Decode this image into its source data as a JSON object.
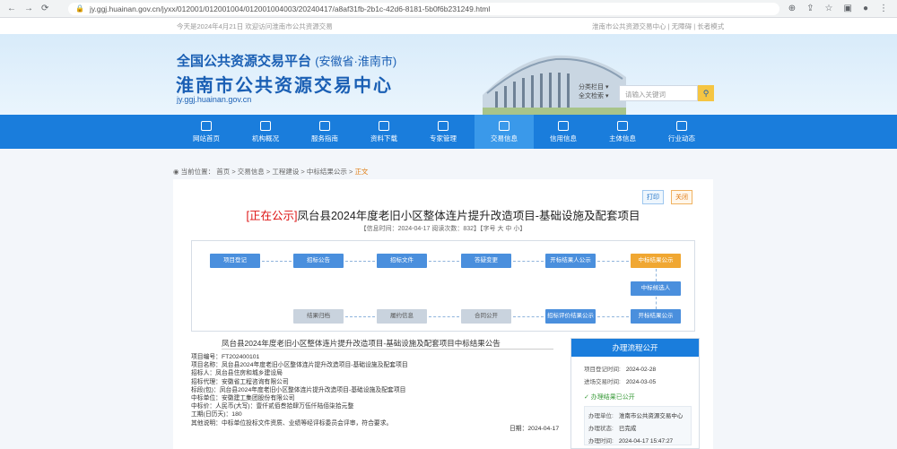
{
  "browser": {
    "url": "jy.ggj.huainan.gov.cn/jyxx/012001/012001004/012001004003/20240417/a8af31fb-2b1c-42d6-8181-5b0f6b231249.html"
  },
  "topbar": {
    "left": "今天是2024年4月21日 欢迎访问淮南市公共资源交易",
    "right": "淮南市公共资源交易中心 | 无障碍 | 长者模式"
  },
  "banner": {
    "title1": "全国公共资源交易平台",
    "title1_region": "(安徽省·淮南市)",
    "title2": "淮南市公共资源交易中心",
    "site": "jy.ggj.huainan.gov.cn"
  },
  "search": {
    "select1": "分类栏目",
    "select2": "全文检索",
    "placeholder": "请输入关键词",
    "button": "搜索"
  },
  "menu": [
    {
      "label": "网站首页",
      "icon": "home-icon"
    },
    {
      "label": "机构概况",
      "icon": "building-icon"
    },
    {
      "label": "服务指南",
      "icon": "guide-icon"
    },
    {
      "label": "资料下载",
      "icon": "download-icon"
    },
    {
      "label": "专家管理",
      "icon": "expert-icon"
    },
    {
      "label": "交易信息",
      "icon": "trade-icon"
    },
    {
      "label": "信用信息",
      "icon": "credit-icon"
    },
    {
      "label": "主体信息",
      "icon": "subject-icon"
    },
    {
      "label": "行业动态",
      "icon": "news-icon"
    }
  ],
  "crumb": {
    "prefix": "当前位置：",
    "path": "首页 > 交易信息 > 工程建设 > 中标结果公示 >",
    "current": "正文"
  },
  "tags": {
    "print": "打印",
    "close": "关闭"
  },
  "article": {
    "status": "[正在公示]",
    "title": "凤台县2024年度老旧小区整体连片提升改造项目-基础设施及配套项目",
    "meta": "【信息时间：2024-04-17 阅读次数：832】【字号 大 中 小】"
  },
  "flow": {
    "row1": [
      "项目登记",
      "招标公告",
      "招标文件",
      "答疑变更",
      "开标结果人公示",
      "中标结果公示"
    ],
    "col": [
      "中标候选人",
      "开标结果公示"
    ],
    "row2": [
      "结果归档",
      "履约信息",
      "合同公开",
      "招标评价结果公示"
    ]
  },
  "doc": {
    "title": "凤台县2024年度老旧小区整体连片提升改造项目-基础设施及配套项目中标结果公告",
    "lines": [
      "项目编号：FT202400101",
      "项目名称：凤台县2024年度老旧小区整体连片提升改造项目-基础设施及配套项目",
      "招标人：凤台县住房和城乡建设局",
      "招标代理：安徽省工程咨询有限公司",
      "标段(包)：凤台县2024年度老旧小区整体连片提升改造项目-基础设施及配套项目",
      "中标单位：安徽建工集团股份有限公司",
      "中标价：人民币(大写)：壹仟贰佰叁拾肆万伍仟陆佰柒拾元整",
      "工期(日历天)：180",
      "其他说明：中标单位投标文件资质、业绩等经评标委员会评审，符合要求。"
    ],
    "date": "日期：2024-04-17"
  },
  "side": {
    "header": "办理流程公开",
    "rows": [
      {
        "k": "项目登记时间:",
        "v": "2024-02-28"
      },
      {
        "k": "进场交易时间:",
        "v": "2024-03-05"
      }
    ],
    "status": "✓ 办理结果已公开",
    "card": [
      {
        "k": "办理单位:",
        "v": "淮南市公共资源交易中心"
      },
      {
        "k": "办理状态:",
        "v": "已完成"
      },
      {
        "k": "办理时间:",
        "v": "2024-04-17 15:47:27"
      }
    ]
  },
  "colors": {
    "primary": "#1a7ddc",
    "accent": "#f0a732",
    "status": "#dd1111"
  }
}
